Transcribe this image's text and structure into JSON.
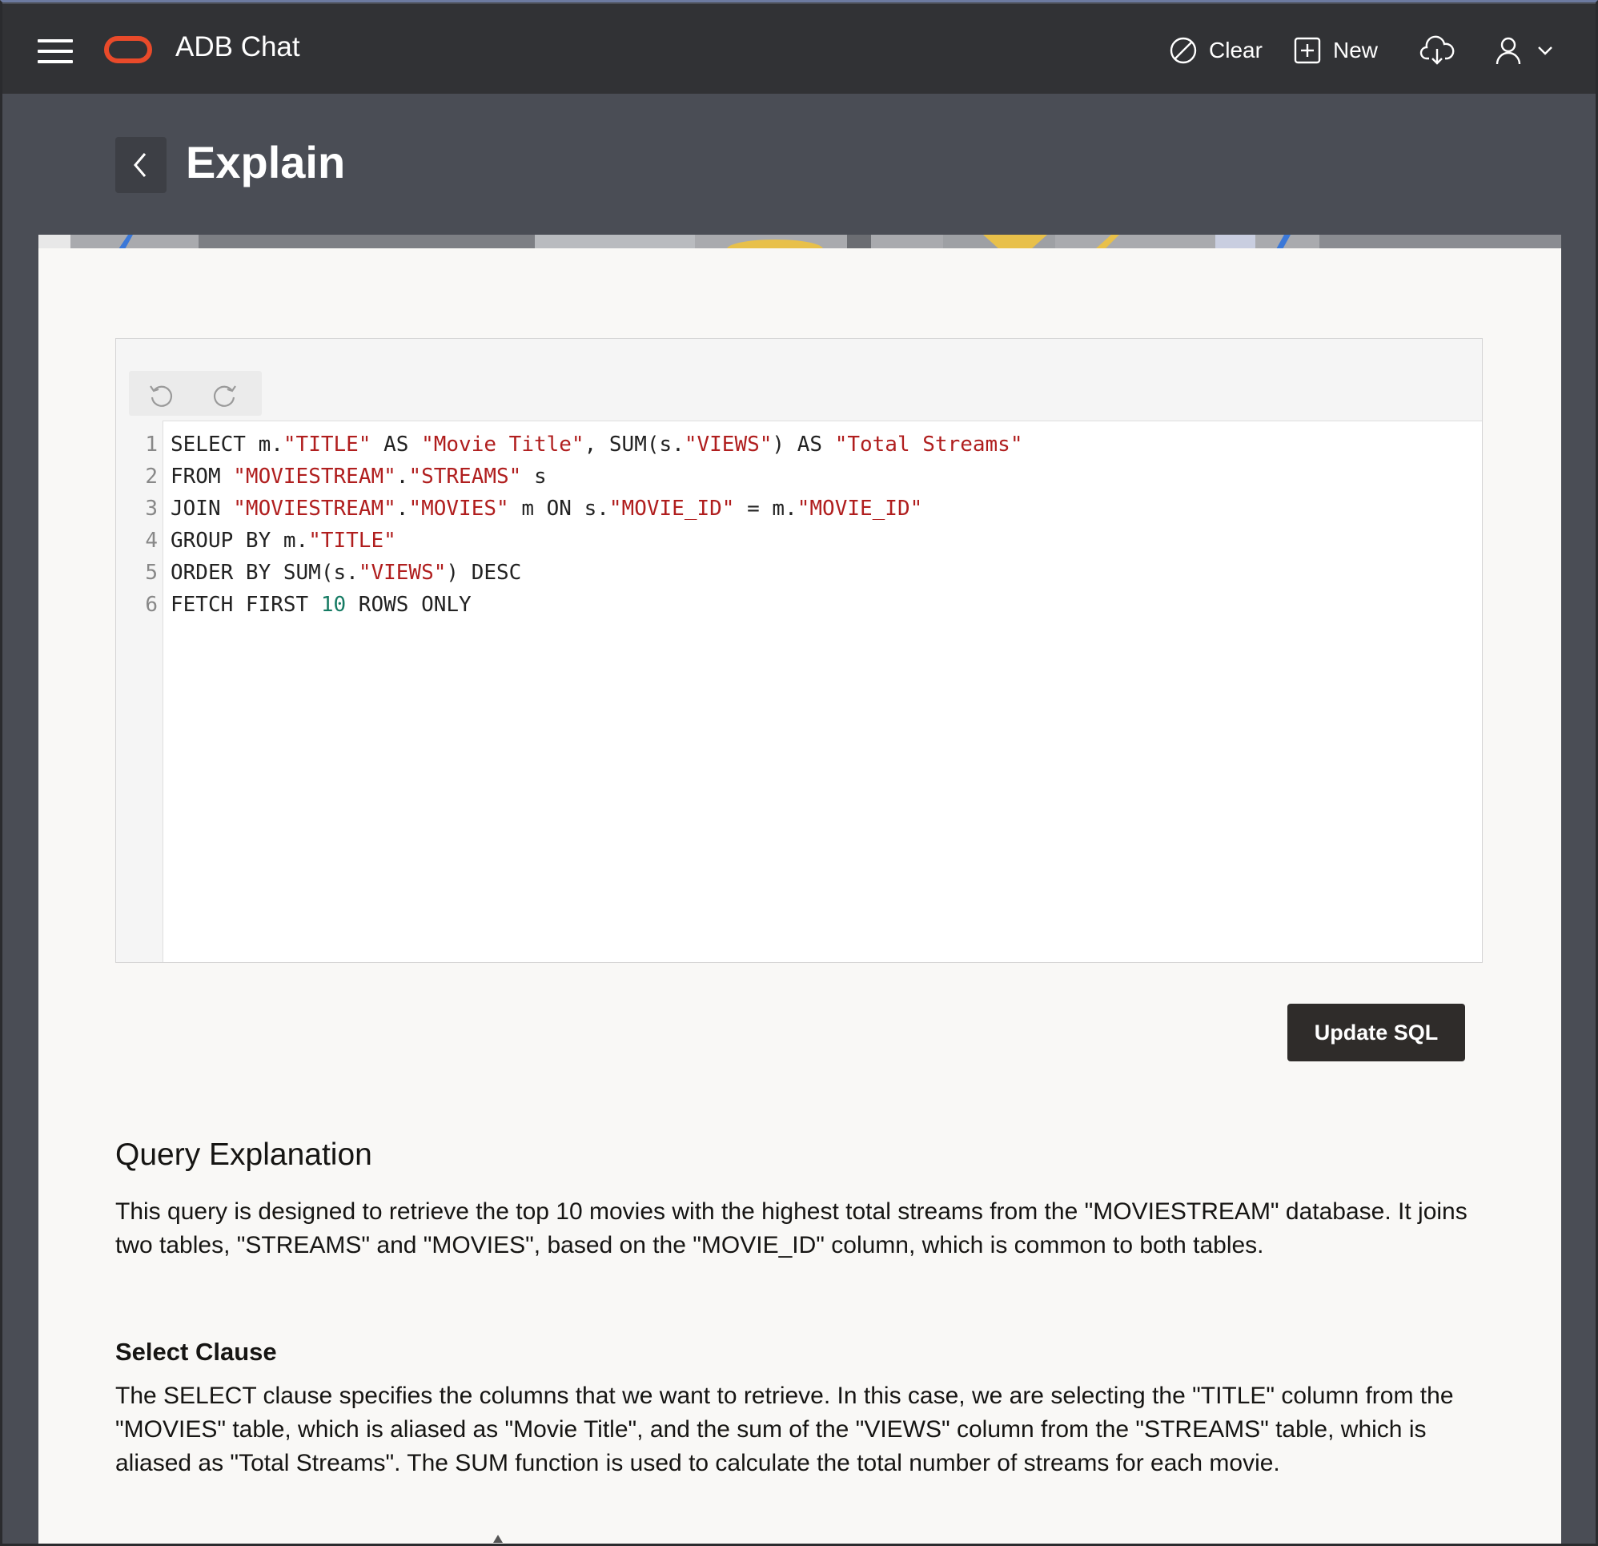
{
  "app": {
    "title": "ADB Chat"
  },
  "header": {
    "clear_label": "Clear",
    "new_label": "New",
    "icons": [
      "menu-icon",
      "oracle-logo",
      "clear-icon",
      "new-icon",
      "download-icon",
      "user-icon",
      "chevron-down-icon"
    ]
  },
  "page": {
    "title": "Explain"
  },
  "editor": {
    "lines": [
      {
        "n": "1",
        "tokens": [
          {
            "t": "SELECT m.",
            "c": "kw"
          },
          {
            "t": "\"TITLE\"",
            "c": "str"
          },
          {
            "t": " AS ",
            "c": "kw"
          },
          {
            "t": "\"Movie Title\"",
            "c": "str"
          },
          {
            "t": ", SUM(s.",
            "c": "kw"
          },
          {
            "t": "\"VIEWS\"",
            "c": "str"
          },
          {
            "t": ") AS ",
            "c": "kw"
          },
          {
            "t": "\"Total Streams\"",
            "c": "str"
          }
        ]
      },
      {
        "n": "2",
        "tokens": [
          {
            "t": "FROM ",
            "c": "kw"
          },
          {
            "t": "\"MOVIESTREAM\"",
            "c": "str"
          },
          {
            "t": ".",
            "c": "kw"
          },
          {
            "t": "\"STREAMS\"",
            "c": "str"
          },
          {
            "t": " s",
            "c": "kw"
          }
        ]
      },
      {
        "n": "3",
        "tokens": [
          {
            "t": "JOIN ",
            "c": "kw"
          },
          {
            "t": "\"MOVIESTREAM\"",
            "c": "str"
          },
          {
            "t": ".",
            "c": "kw"
          },
          {
            "t": "\"MOVIES\"",
            "c": "str"
          },
          {
            "t": " m ON s.",
            "c": "kw"
          },
          {
            "t": "\"MOVIE_ID\"",
            "c": "str"
          },
          {
            "t": " = m.",
            "c": "kw"
          },
          {
            "t": "\"MOVIE_ID\"",
            "c": "str"
          }
        ]
      },
      {
        "n": "4",
        "tokens": [
          {
            "t": "GROUP BY m.",
            "c": "kw"
          },
          {
            "t": "\"TITLE\"",
            "c": "str"
          }
        ]
      },
      {
        "n": "5",
        "tokens": [
          {
            "t": "ORDER BY SUM(s.",
            "c": "kw"
          },
          {
            "t": "\"VIEWS\"",
            "c": "str"
          },
          {
            "t": ") DESC",
            "c": "kw"
          }
        ]
      },
      {
        "n": "6",
        "tokens": [
          {
            "t": "FETCH FIRST ",
            "c": "kw"
          },
          {
            "t": "10",
            "c": "num"
          },
          {
            "t": " ROWS ONLY",
            "c": "kw"
          }
        ]
      }
    ]
  },
  "actions": {
    "update_label": "Update SQL"
  },
  "explanation": {
    "title": "Query Explanation",
    "intro": "This query is designed to retrieve the top 10 movies with the highest total streams from the \"MOVIESTREAM\" database. It joins two tables, \"STREAMS\" and \"MOVIES\", based on the \"MOVIE_ID\" column, which is common to both tables.",
    "select_title": "Select Clause",
    "select_text": "The SELECT clause specifies the columns that we want to retrieve. In this case, we are selecting the \"TITLE\" column from the \"MOVIES\" table, which is aliased as \"Movie Title\", and the sum of the \"VIEWS\" column from the \"STREAMS\" table, which is aliased as \"Total Streams\". The SUM function is used to calculate the total number of streams for each movie."
  },
  "colors": {
    "header_bg": "#313235",
    "page_bg": "#4a4d55",
    "logo": "#e94a2a",
    "string_token": "#b01e1e",
    "number_token": "#157b63",
    "primary_button": "#2f2c2a"
  }
}
